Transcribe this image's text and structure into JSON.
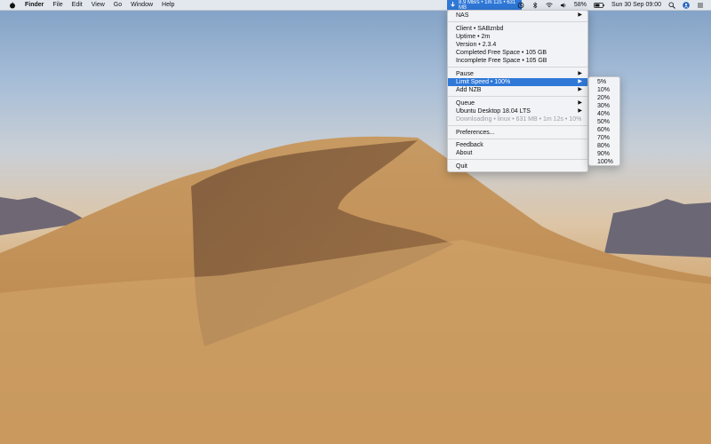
{
  "menubar": {
    "app_name": "Finder",
    "menus": [
      "File",
      "Edit",
      "View",
      "Go",
      "Window",
      "Help"
    ],
    "sab_status": "8.9 MB/s • 1m 12s • 631 MB",
    "battery": "58%",
    "clock": "Sun 30 Sep  09:00",
    "icons": [
      "apple-icon",
      "sabnzbd-download-icon",
      "time-machine-icon",
      "bluetooth-icon",
      "wifi-icon",
      "volume-icon",
      "battery-icon",
      "spotlight-icon",
      "user-icon",
      "notification-icon"
    ]
  },
  "main_menu": {
    "items": [
      {
        "label": "NAS"
      },
      {
        "label": "Client • SABznbd"
      },
      {
        "label": "Uptime • 2m"
      },
      {
        "label": "Version • 2.3.4"
      },
      {
        "label": "Completed Free Space • 105 GB"
      },
      {
        "label": "Incomplete Free Space • 105 GB"
      },
      {
        "label": "Pause"
      },
      {
        "label": "Limit Speed • 100%"
      },
      {
        "label": "Add NZB"
      },
      {
        "label": "Queue"
      },
      {
        "label": "Ubuntu Desktop 18.04 LTS"
      },
      {
        "label": "Downloading • linux • 631 MB • 1m 12s • 10%"
      },
      {
        "label": "Preferences..."
      },
      {
        "label": "Feedback"
      },
      {
        "label": "About"
      },
      {
        "label": "Quit"
      }
    ],
    "submenu_arrow": "▶",
    "highlight_color": "#2f78d8"
  },
  "speed_submenu": {
    "options": [
      "5%",
      "10%",
      "20%",
      "30%",
      "40%",
      "50%",
      "60%",
      "70%",
      "80%",
      "90%",
      "100%"
    ]
  }
}
